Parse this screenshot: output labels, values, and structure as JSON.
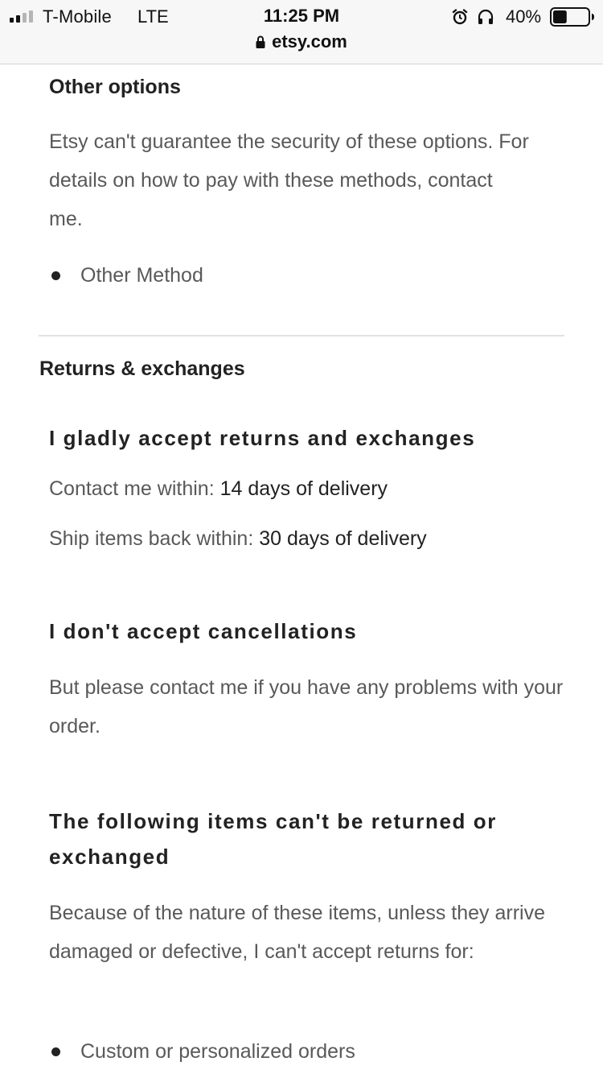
{
  "status_bar": {
    "carrier": "T-Mobile",
    "network": "LTE",
    "time": "11:25 PM",
    "battery_percent": "40%",
    "battery_level": 0.4,
    "url": "etsy.com",
    "icons": [
      "signal-icon",
      "alarm-icon",
      "headphones-icon",
      "battery-icon",
      "lock-icon"
    ]
  },
  "payment": {
    "other_options_title": "Other options",
    "other_options_text": "Etsy can't guarantee the security of these options. For details on how to pay with these methods, contact me.",
    "methods": [
      "Other Method"
    ]
  },
  "returns": {
    "section_title": "Returns & exchanges",
    "accept_title": "I gladly accept returns and exchanges",
    "contact_label": "Contact me within:",
    "contact_value": "14 days of delivery",
    "ship_label": "Ship items back within:",
    "ship_value": "30 days of delivery",
    "cancellations_title": "I don't accept cancellations",
    "cancellations_text": "But please contact me if you have any problems with your order.",
    "exceptions_title": "The following items can't be returned or exchanged",
    "exceptions_text": "Because of the nature of these items, unless they arrive damaged or defective, I can't accept returns for:",
    "exception_items": [
      "Custom or personalized orders"
    ]
  }
}
